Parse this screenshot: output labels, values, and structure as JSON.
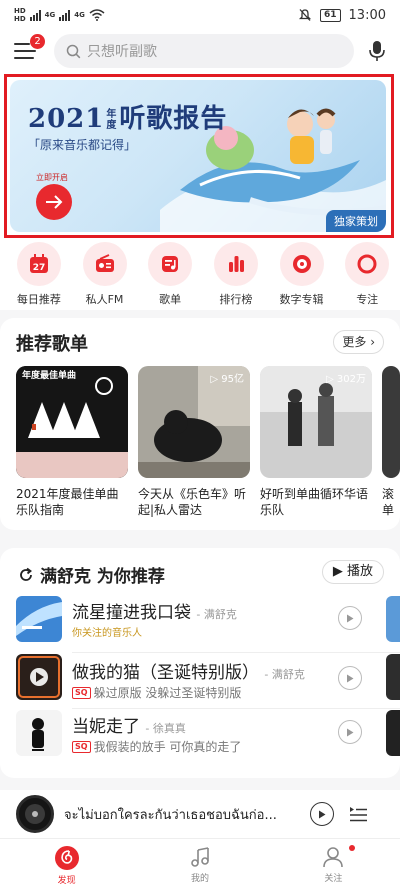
{
  "status_bar": {
    "network_1": "4G",
    "network_2": "4G",
    "battery": "61",
    "time": "13:00"
  },
  "header": {
    "menu_badge": "2",
    "search_placeholder": "只想听副歌"
  },
  "banner": {
    "title_year": "2021",
    "title_small_top": "年",
    "title_small_bottom": "度",
    "title_main": "听歌报告",
    "subtitle": "「原来音乐都记得」",
    "cta_label": "立即开启",
    "tag": "独家策划"
  },
  "quick_nav": [
    {
      "label": "每日推荐",
      "icon": "calendar-icon",
      "day": "27"
    },
    {
      "label": "私人FM",
      "icon": "radio-icon"
    },
    {
      "label": "歌单",
      "icon": "playlist-icon"
    },
    {
      "label": "排行榜",
      "icon": "chart-icon"
    },
    {
      "label": "数字专辑",
      "icon": "vinyl-icon"
    },
    {
      "label": "专注",
      "icon": "focus-icon"
    }
  ],
  "playlists": {
    "title": "推荐歌单",
    "more": "更多",
    "items": [
      {
        "title": "2021年度最佳单曲乐队指南",
        "count": "",
        "cover_text": "年度最佳单曲"
      },
      {
        "title": "今天从《乐色车》听起|私人雷达",
        "count": "95亿"
      },
      {
        "title": "好听到单曲循环华语乐队",
        "count": "302万"
      },
      {
        "title": "滚单",
        "count": ""
      }
    ]
  },
  "recommend": {
    "title": "满舒克 为你推荐",
    "play_label": "播放",
    "songs": [
      {
        "title": "流星撞进我口袋",
        "artist": "- 满舒克",
        "sub": "你关注的音乐人",
        "quality": ""
      },
      {
        "title": "做我的猫（圣诞特别版）",
        "artist": "- 满舒克",
        "sub": "躲过原版 没躲过圣诞特别版",
        "quality": "SQ"
      },
      {
        "title": "当妮走了",
        "artist": "- 徐真真",
        "sub": "我假装的放手 可你真的走了",
        "quality": "SQ"
      }
    ]
  },
  "mini_player": {
    "title": "จะไม่บอกใครละกันว่าเธอชอบฉันก่อ..."
  },
  "tabs": [
    {
      "label": "发现",
      "active": true
    },
    {
      "label": "我的",
      "active": false
    },
    {
      "label": "关注",
      "active": false
    }
  ],
  "colors": {
    "accent": "#e8292e",
    "banner_blue": "#1f3c7a"
  }
}
